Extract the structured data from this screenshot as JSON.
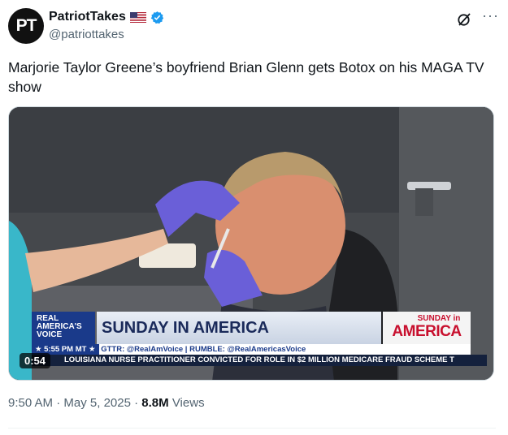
{
  "author": {
    "avatar_text": "PT",
    "display_name": "PatriotTakes",
    "handle": "@patriottakes",
    "flag_icon": "us-flag-icon",
    "verified_icon": "verified-badge-icon"
  },
  "tweet": {
    "text": "Marjorie Taylor Greene’s boyfriend Brian Glenn gets Botox on his MAGA TV show"
  },
  "video": {
    "duration": "0:54",
    "broadcast": {
      "network_logo_line1": "REAL",
      "network_logo_line2": "AMERICA'S",
      "network_logo_line3": "VOICE",
      "headline": "SUNDAY IN AMERICA",
      "time": "★ 5:55 PM MT ★",
      "socials": "GTTR: @RealAmVoice | RUMBLE: @RealAmericasVoice",
      "show_logo_line1": "SUNDAY in",
      "show_logo_line2": "AMERICA",
      "ticker": "LOUISIANA NURSE PRACTITIONER CONVICTED FOR ROLE IN $2 MILLION MEDICARE FRAUD SCHEME   T"
    }
  },
  "meta": {
    "time": "9:50 AM",
    "sep1": " · ",
    "date": "May 5, 2025",
    "sep2": " · ",
    "views_count": "8.8M",
    "views_label": " Views"
  },
  "colors": {
    "verified": "#1d9bf0",
    "text_secondary": "#536471",
    "network_blue": "#1a3a8a",
    "brand_red": "#c8102e"
  }
}
